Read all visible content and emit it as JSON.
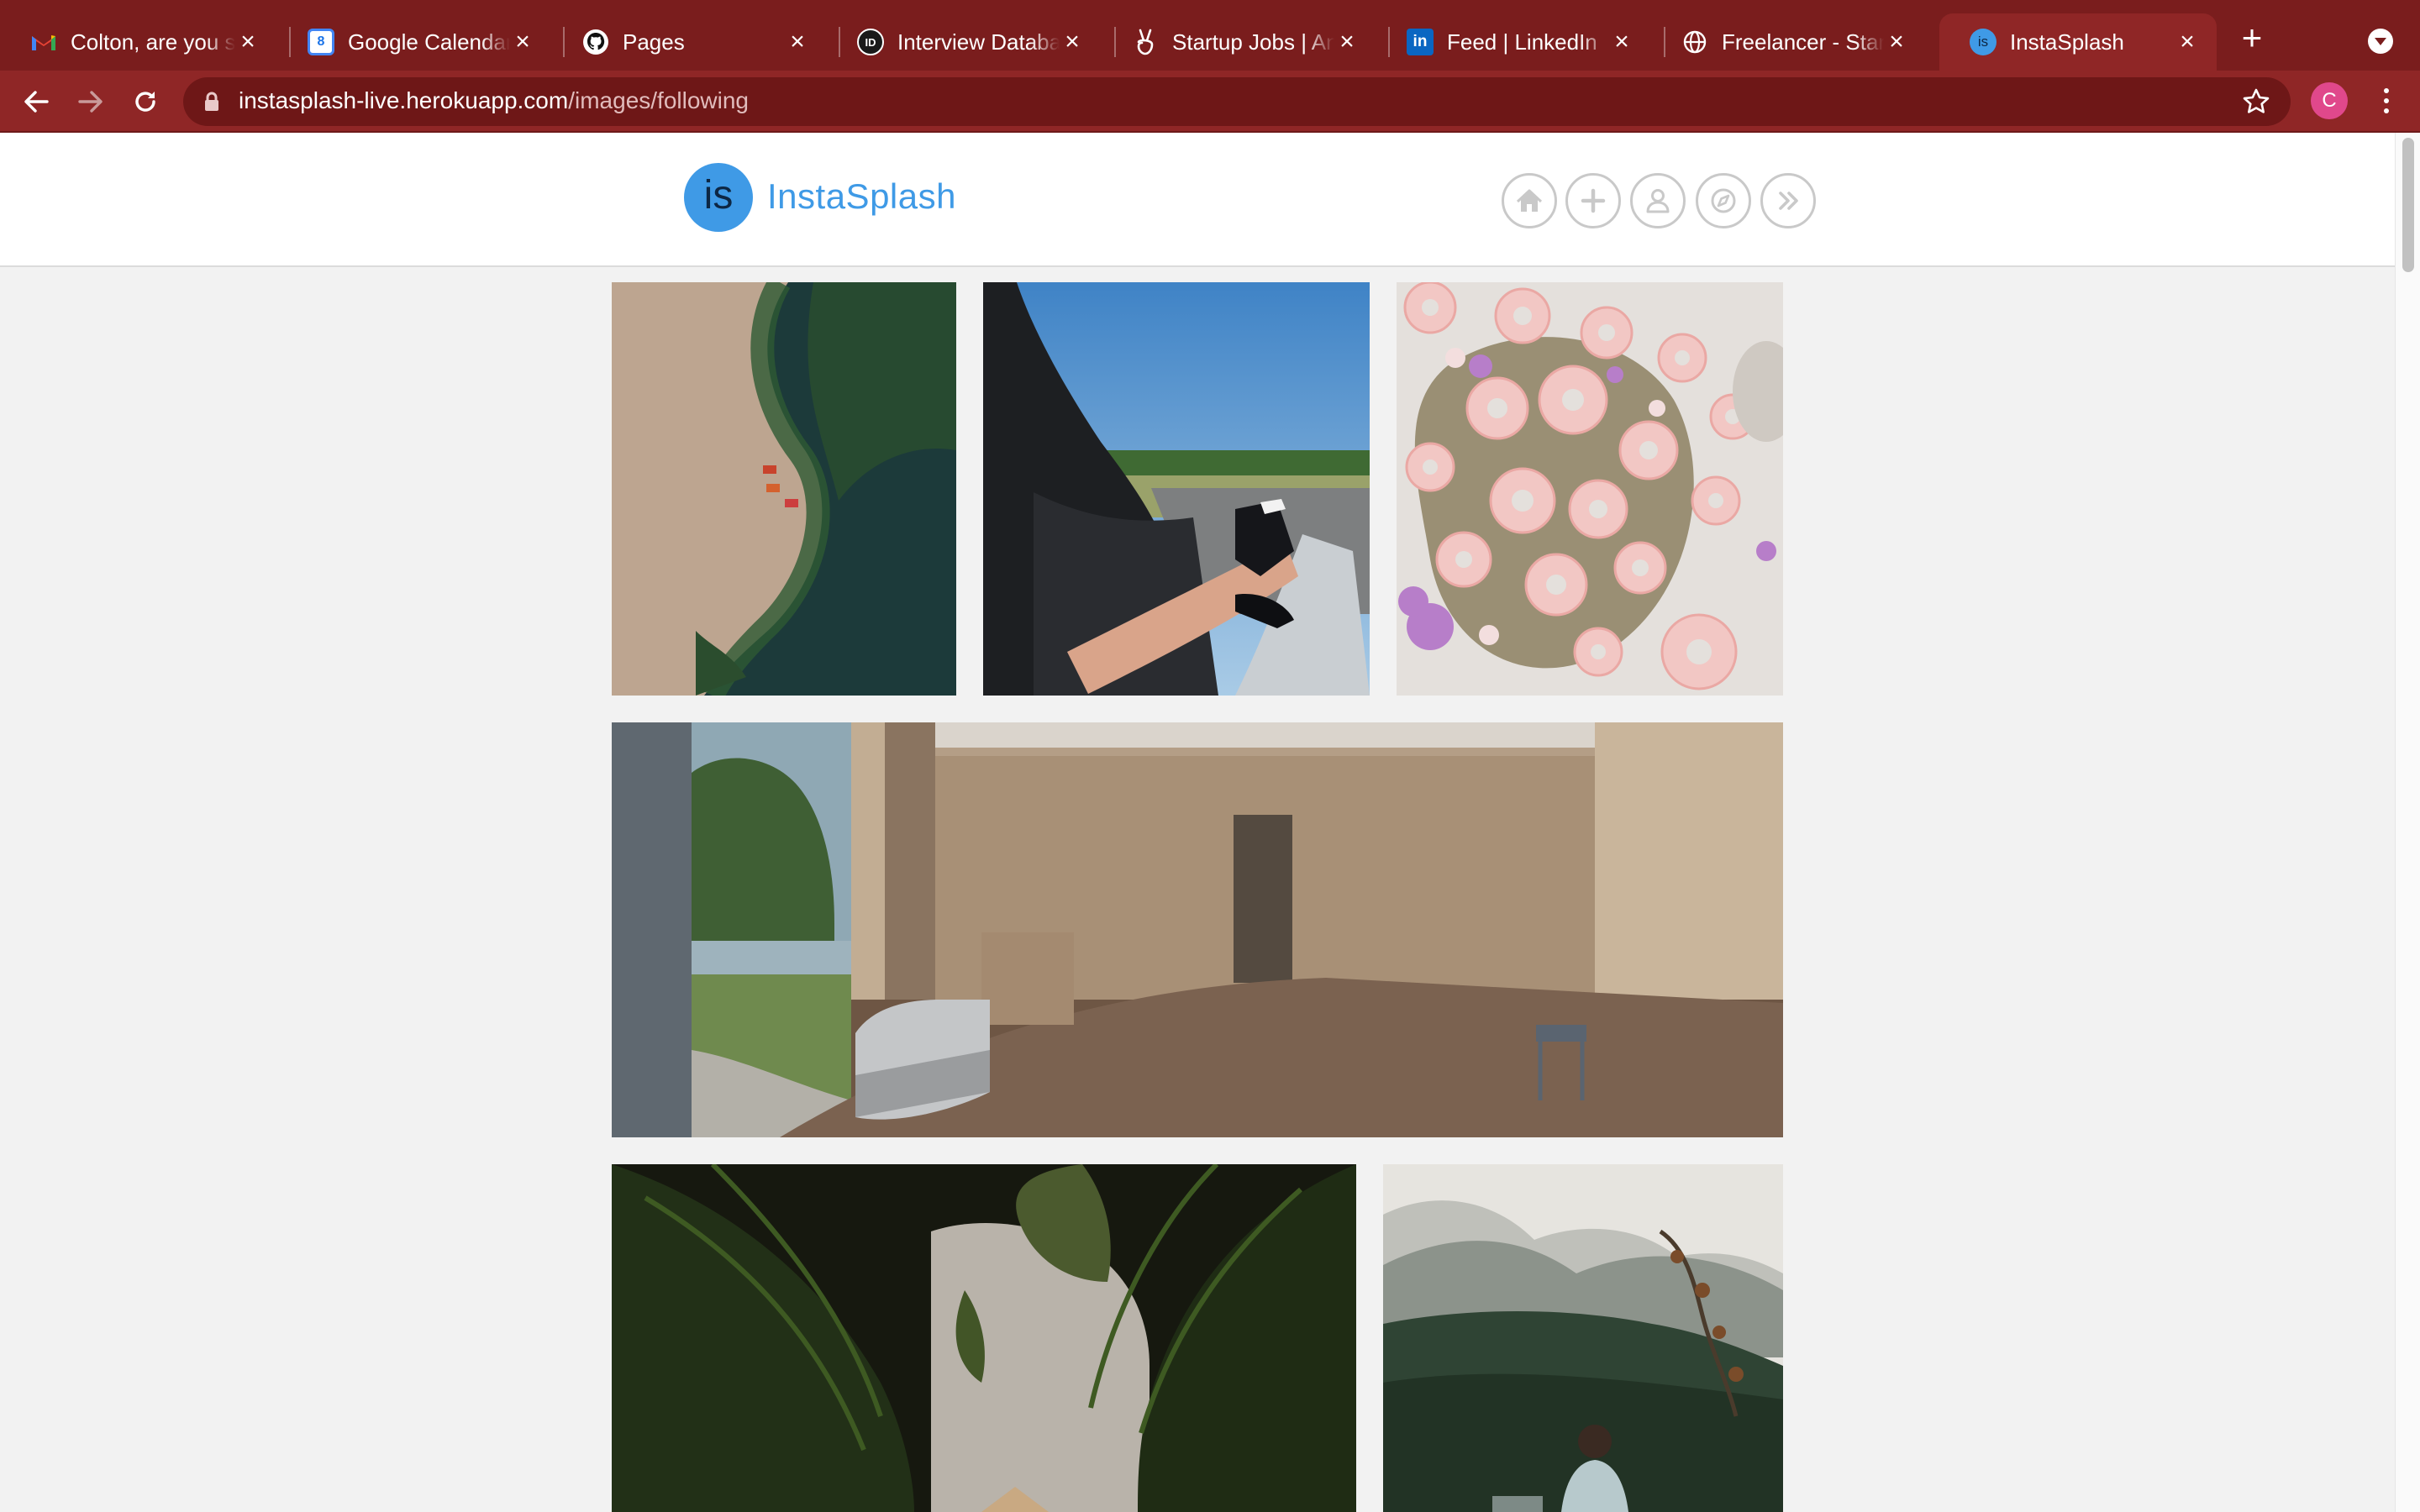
{
  "browser": {
    "tabs": [
      {
        "title": "Colton, are you still looking",
        "icon": "gmail-icon",
        "active": false
      },
      {
        "title": "Google Calendar",
        "icon": "calendar-icon",
        "active": false
      },
      {
        "title": "Pages",
        "icon": "github-icon",
        "active": false
      },
      {
        "title": "Interview Database",
        "icon": "interview-db-icon",
        "active": false
      },
      {
        "title": "Startup Jobs | AngelList",
        "icon": "angellist-icon",
        "active": false
      },
      {
        "title": "Feed | LinkedIn",
        "icon": "linkedin-icon",
        "active": false
      },
      {
        "title": "Freelancer - Start",
        "icon": "globe-icon",
        "active": false
      },
      {
        "title": "InstaSplash",
        "icon": "instasplash-favicon-icon",
        "active": true
      }
    ],
    "calendar_icon_day": "8",
    "url_host": "instasplash-live.herokuapp.com",
    "url_path": "/images/following",
    "profile_initial": "C",
    "theme_color": "#7a1d1d"
  },
  "site": {
    "logo_mark": "is",
    "name": "InstaSplash",
    "brand_color": "#3f9ae6",
    "nav": [
      {
        "name": "home",
        "icon": "home-icon"
      },
      {
        "name": "add-image",
        "icon": "plus-icon"
      },
      {
        "name": "profile",
        "icon": "user-icon"
      },
      {
        "name": "explore",
        "icon": "compass-icon"
      },
      {
        "name": "following",
        "icon": "double-chevron-right-icon"
      }
    ]
  },
  "feed": {
    "images": [
      {
        "subject": "aerial-beach-kayaks"
      },
      {
        "subject": "feet-out-car-window"
      },
      {
        "subject": "pink-donuts-with-flowers"
      },
      {
        "subject": "wooden-interior-living-room"
      },
      {
        "subject": "palm-fronds-jungle"
      },
      {
        "subject": "person-facing-mountains"
      }
    ]
  }
}
